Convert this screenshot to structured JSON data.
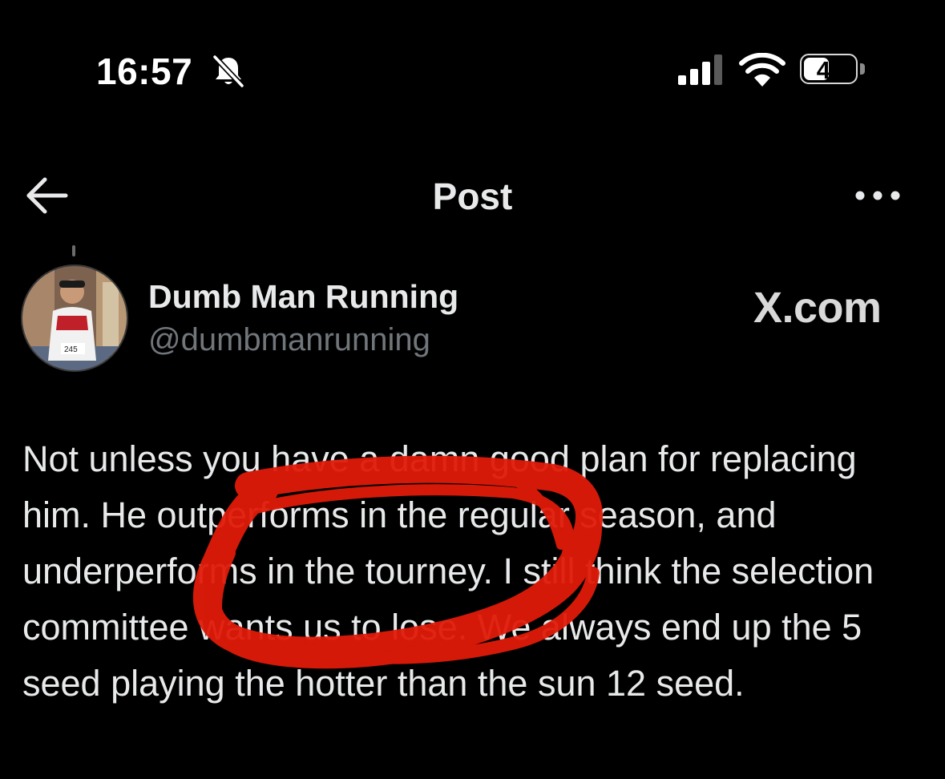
{
  "status_bar": {
    "time": "16:57",
    "battery_level": "47",
    "battery_fraction": 0.47,
    "icons": [
      "bell-slash-icon",
      "cellular-signal-icon",
      "wifi-icon",
      "battery-icon"
    ]
  },
  "nav": {
    "title": "Post",
    "back_icon": "arrow-left-icon",
    "more_icon": "more-horizontal-icon"
  },
  "author": {
    "display_name": "Dumb Man Running",
    "handle": "@dumbmanrunning"
  },
  "watermark": "X.com",
  "post": {
    "text": "Not unless you have a damn good plan for replacing him. He outperforms in the regular season, and underperforms in the tourney. I still think the selection committee wants us to lose. We always end up the 5 seed playing the hotter than the sun 12 seed."
  },
  "annotation": {
    "color": "#e01b0a"
  }
}
